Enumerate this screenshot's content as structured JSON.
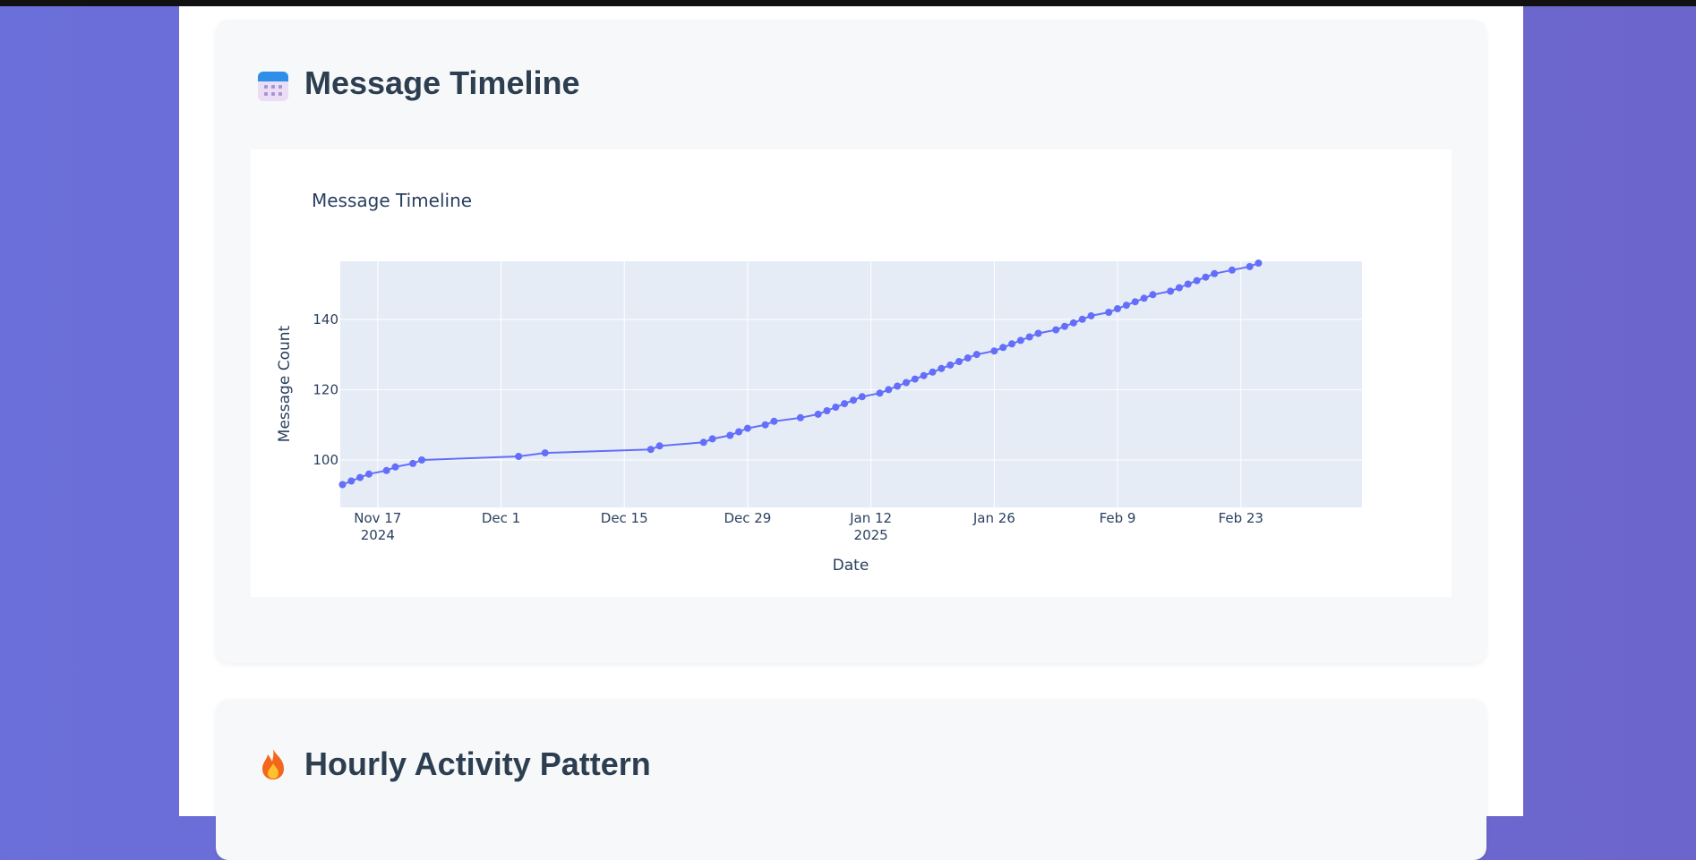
{
  "sections": {
    "timeline": {
      "title": "Message Timeline",
      "icon": "calendar-icon"
    },
    "hourly": {
      "title": "Hourly Activity Pattern",
      "icon": "fire-icon"
    }
  },
  "chart_data": {
    "type": "line",
    "mode": "lines+markers",
    "title": "Message Timeline",
    "xlabel": "Date",
    "ylabel": "Message Count",
    "x_tick_labels": [
      {
        "date": "2024-11-17",
        "line1": "Nov 17",
        "line2": "2024"
      },
      {
        "date": "2024-12-01",
        "line1": "Dec 1",
        "line2": ""
      },
      {
        "date": "2024-12-15",
        "line1": "Dec 15",
        "line2": ""
      },
      {
        "date": "2024-12-29",
        "line1": "Dec 29",
        "line2": ""
      },
      {
        "date": "2025-01-12",
        "line1": "Jan 12",
        "line2": "2025"
      },
      {
        "date": "2025-01-26",
        "line1": "Jan 26",
        "line2": ""
      },
      {
        "date": "2025-02-09",
        "line1": "Feb 9",
        "line2": ""
      },
      {
        "date": "2025-02-23",
        "line1": "Feb 23",
        "line2": ""
      }
    ],
    "y_ticks": [
      100,
      120,
      140
    ],
    "xlim": [
      "2024-11-12T18:00",
      "2025-03-08T18:00"
    ],
    "ylim": [
      86.5,
      156.5
    ],
    "grid": true,
    "line_color": "#636efa",
    "plot_bg": "#e5ecf6",
    "series": [
      {
        "x": [
          "2024-11-13",
          "2024-11-14",
          "2024-11-15",
          "2024-11-16",
          "2024-11-18",
          "2024-11-19",
          "2024-11-21",
          "2024-11-22",
          "2024-12-03",
          "2024-12-06",
          "2024-12-18",
          "2024-12-19",
          "2024-12-24",
          "2024-12-25",
          "2024-12-27",
          "2024-12-28",
          "2024-12-29",
          "2024-12-31",
          "2025-01-01",
          "2025-01-04",
          "2025-01-06",
          "2025-01-07",
          "2025-01-08",
          "2025-01-09",
          "2025-01-10",
          "2025-01-11",
          "2025-01-13",
          "2025-01-14",
          "2025-01-15",
          "2025-01-16",
          "2025-01-17",
          "2025-01-18",
          "2025-01-19",
          "2025-01-20",
          "2025-01-21",
          "2025-01-22",
          "2025-01-23",
          "2025-01-24",
          "2025-01-26",
          "2025-01-27",
          "2025-01-28",
          "2025-01-29",
          "2025-01-30",
          "2025-01-31",
          "2025-02-02",
          "2025-02-03",
          "2025-02-04",
          "2025-02-05",
          "2025-02-06",
          "2025-02-08",
          "2025-02-09",
          "2025-02-10",
          "2025-02-11",
          "2025-02-12",
          "2025-02-13",
          "2025-02-15",
          "2025-02-16",
          "2025-02-17",
          "2025-02-18",
          "2025-02-19",
          "2025-02-20",
          "2025-02-22",
          "2025-02-24",
          "2025-02-25"
        ],
        "y": [
          93,
          94,
          95,
          96,
          97,
          98,
          99,
          100,
          101,
          102,
          103,
          104,
          105,
          106,
          107,
          108,
          109,
          110,
          111,
          112,
          113,
          114,
          115,
          116,
          117,
          118,
          119,
          120,
          121,
          122,
          123,
          124,
          125,
          126,
          127,
          128,
          129,
          130,
          131,
          132,
          133,
          134,
          135,
          136,
          137,
          138,
          139,
          140,
          141,
          142,
          143,
          144,
          145,
          146,
          147,
          148,
          149,
          150,
          151,
          152,
          153,
          154,
          155,
          156
        ]
      }
    ]
  }
}
